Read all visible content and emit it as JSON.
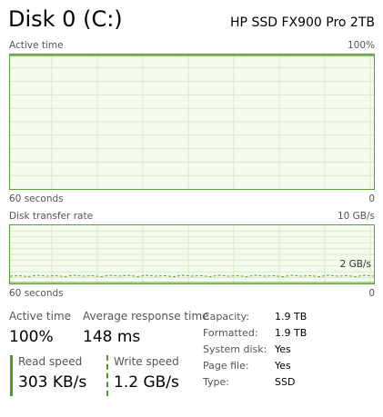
{
  "header": {
    "title": "Disk 0 (C:)",
    "model": "HP SSD FX900 Pro 2TB"
  },
  "active_chart": {
    "label": "Active time",
    "max_label": "100%",
    "time_label": "60 seconds",
    "min_label": "0"
  },
  "transfer_chart": {
    "label": "Disk transfer rate",
    "max_label": "10 GB/s",
    "mid_label": "2 GB/s",
    "time_label": "60 seconds",
    "min_label": "0"
  },
  "stats": {
    "active_time_label": "Active time",
    "active_time_value": "100%",
    "response_label": "Average response time",
    "response_value": "148 ms",
    "read_label": "Read speed",
    "read_value": "303 KB/s",
    "write_label": "Write speed",
    "write_value": "1.2 GB/s"
  },
  "properties": [
    {
      "label": "Capacity:",
      "value": "1.9 TB"
    },
    {
      "label": "Formatted:",
      "value": "1.9 TB"
    },
    {
      "label": "System disk:",
      "value": "Yes"
    },
    {
      "label": "Page file:",
      "value": "Yes"
    },
    {
      "label": "Type:",
      "value": "SSD"
    }
  ],
  "colors": {
    "chart_border": "#5fa130",
    "chart_fill": "#f6fbf0",
    "grid_line": "#cfe4bb",
    "series_line": "#4e9a1e"
  }
}
